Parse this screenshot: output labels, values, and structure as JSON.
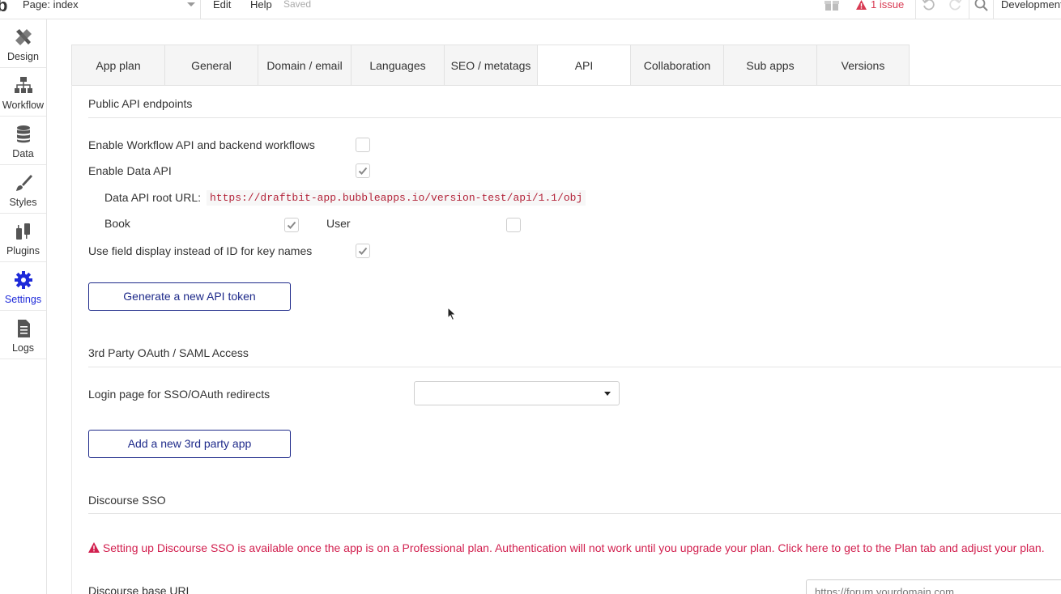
{
  "topbar": {
    "logo": "b",
    "page_label": "Page: index",
    "menu": [
      "Edit",
      "Help"
    ],
    "saved": "Saved",
    "issue_count": "1 issue",
    "environment": "Development"
  },
  "sidebar": {
    "items": [
      {
        "label": "Design",
        "icon": "design-icon"
      },
      {
        "label": "Workflow",
        "icon": "workflow-icon"
      },
      {
        "label": "Data",
        "icon": "database-icon"
      },
      {
        "label": "Styles",
        "icon": "brush-icon"
      },
      {
        "label": "Plugins",
        "icon": "plug-icon"
      },
      {
        "label": "Settings",
        "icon": "gear-icon",
        "active": true
      },
      {
        "label": "Logs",
        "icon": "document-icon"
      }
    ]
  },
  "tabs": [
    {
      "label": "App plan"
    },
    {
      "label": "General"
    },
    {
      "label": "Domain / email"
    },
    {
      "label": "Languages"
    },
    {
      "label": "SEO / metatags"
    },
    {
      "label": "API",
      "active": true
    },
    {
      "label": "Collaboration"
    },
    {
      "label": "Sub apps"
    },
    {
      "label": "Versions"
    }
  ],
  "api": {
    "title": "Public API endpoints",
    "workflow_api_label": "Enable Workflow API and backend workflows",
    "workflow_api_checked": false,
    "data_api_label": "Enable Data API",
    "data_api_checked": true,
    "root_url_label": "Data API root URL:",
    "root_url": "https://draftbit-app.bubbleapps.io/version-test/api/1.1/obj",
    "types": [
      {
        "label": "Book",
        "checked": true
      },
      {
        "label": "User",
        "checked": false
      }
    ],
    "field_display_label": "Use field display instead of ID for key names",
    "field_display_checked": true,
    "generate_token_label": "Generate a new API token"
  },
  "oauth": {
    "title": "3rd Party OAuth / SAML Access",
    "login_page_label": "Login page for SSO/OAuth redirects",
    "login_page_value": "",
    "add_app_label": "Add a new 3rd party app"
  },
  "discourse": {
    "title": "Discourse SSO",
    "warning": "Setting up Discourse SSO is available once the app is on a Professional plan. Authentication will not work until you upgrade your plan. Click here to get to the Plan tab and adjust your plan.",
    "base_url_label": "Discourse base URL",
    "base_url_placeholder": "https://forum.yourdomain.com"
  },
  "colors": {
    "accent": "#1e2ad9",
    "button_border": "#1e2a8a",
    "warning": "#d2204f",
    "url_text": "#b3243a"
  }
}
